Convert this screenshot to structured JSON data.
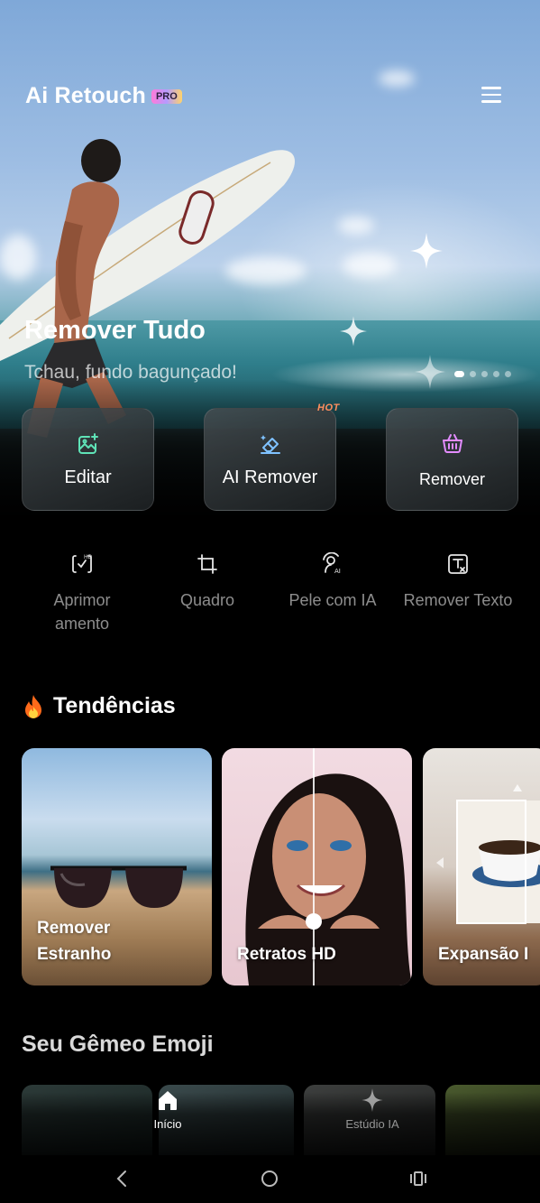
{
  "app": {
    "brand": "Ai Retouch",
    "badge": "PRO"
  },
  "hero": {
    "title": "Remover Tudo",
    "subtitle": "Tchau, fundo bagunçado!",
    "slides_total": 5,
    "active_slide": 1
  },
  "features": [
    {
      "label": "Editar",
      "icon": "edit-image-icon",
      "color": "#5fe3b7"
    },
    {
      "label": "AI Remover",
      "icon": "eraser-icon",
      "color": "#7fc2ff",
      "badge": "HOT"
    },
    {
      "label": "Remover",
      "icon": "basket-icon",
      "color": "#e38cff"
    }
  ],
  "tools": [
    {
      "label_line1": "Aprimor",
      "label_line2": "amento",
      "icon": "hd-enhance-icon"
    },
    {
      "label_line1": "Quadro",
      "label_line2": "",
      "icon": "crop-icon"
    },
    {
      "label_line1": "Pele com IA",
      "label_line2": "",
      "icon": "ai-skin-icon"
    },
    {
      "label_line1": "Remover Texto",
      "label_line2": "",
      "icon": "remove-text-icon"
    }
  ],
  "trends": {
    "title": "Tendências",
    "icon": "fire-icon",
    "cards": [
      {
        "line1": "Remover",
        "line2": "Estranho"
      },
      {
        "line1": "Retratos HD",
        "line2": ""
      },
      {
        "line1": "Expansão I",
        "line2": ""
      }
    ]
  },
  "emoji_section": {
    "title": "Seu Gêmeo Emoji"
  },
  "bottom_nav": {
    "home": "Início",
    "studio": "Estúdio IA"
  },
  "colors": {
    "accent_orange": "#ff8f5e",
    "background": "#000000"
  }
}
